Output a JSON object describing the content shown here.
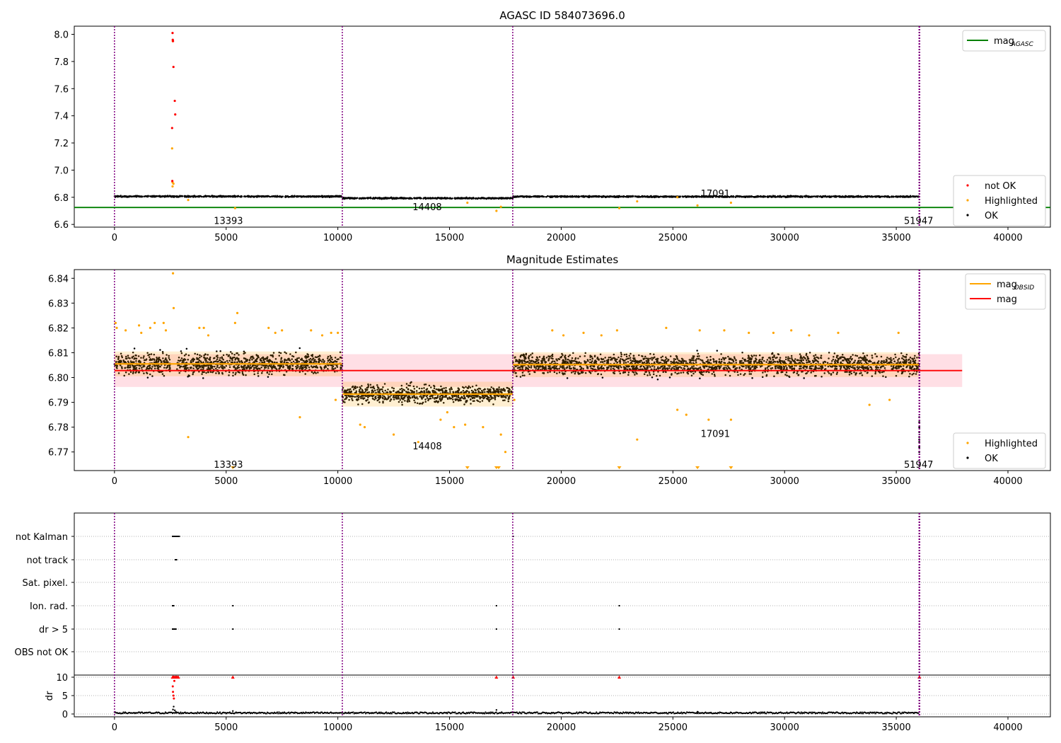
{
  "chart_data": [
    {
      "type": "scatter",
      "title": "AGASC ID 584073696.0",
      "xlim": [
        -1800,
        41900
      ],
      "ylim": [
        6.58,
        8.06
      ],
      "xticks": [
        0,
        5000,
        10000,
        15000,
        20000,
        25000,
        30000,
        35000,
        40000
      ],
      "yticks": [
        6.6,
        6.8,
        7.0,
        7.2,
        7.4,
        7.6,
        7.8,
        8.0
      ],
      "grid": false,
      "obs_boundaries": [
        0,
        10200,
        17830,
        36020,
        36050
      ],
      "obs_labels": [
        {
          "text": "13393",
          "x": 5100,
          "y": 6.63
        },
        {
          "text": "14408",
          "x": 14000,
          "y": 6.73
        },
        {
          "text": "17091",
          "x": 26900,
          "y": 6.83
        },
        {
          "text": "51947",
          "x": 36000,
          "y": 6.63
        }
      ],
      "lines": [
        {
          "name": "mag$_{AGASC}$",
          "display_main": "mag",
          "display_sub": "AGASC",
          "color": "#008000",
          "y": 6.725,
          "x": [
            -1800,
            41900
          ]
        }
      ],
      "legend_upper": {
        "position": "top-right",
        "entries": [
          {
            "main": "mag",
            "sub": "AGASC",
            "color": "#008000",
            "kind": "line"
          }
        ]
      },
      "legend_lower": {
        "position": "bottom-right",
        "entries": [
          {
            "label": "not OK",
            "color": "#ff0000",
            "kind": "dot"
          },
          {
            "label": "Highlighted",
            "color": "#ffa500",
            "kind": "dot"
          },
          {
            "label": "OK",
            "color": "#000000",
            "kind": "dot"
          }
        ]
      },
      "series": [
        {
          "name": "OK",
          "color": "#000000",
          "segments": [
            {
              "x0": 0,
              "x1": 10200,
              "center": 6.806,
              "spread": 0.006
            },
            {
              "x0": 10200,
              "x1": 17830,
              "center": 6.793,
              "spread": 0.006
            },
            {
              "x0": 17830,
              "x1": 36020,
              "center": 6.805,
              "spread": 0.006
            }
          ]
        },
        {
          "name": "not OK",
          "color": "#ff0000",
          "x": [
            2600,
            2610,
            2620,
            2640,
            2700,
            2720,
            2580,
            2590
          ],
          "y": [
            8.01,
            7.96,
            7.95,
            7.76,
            7.51,
            7.41,
            7.31,
            6.92
          ]
        },
        {
          "name": "Highlighted",
          "color": "#ffa500",
          "x": [
            2580,
            2600,
            2640,
            3300,
            5400,
            15800,
            17100,
            17300,
            22600,
            23400,
            25200,
            26100,
            27600,
            2600,
            2610
          ],
          "y": [
            7.16,
            6.88,
            6.9,
            6.78,
            6.72,
            6.76,
            6.7,
            6.73,
            6.72,
            6.77,
            6.8,
            6.74,
            6.76,
            6.91,
            7.95
          ]
        }
      ]
    },
    {
      "type": "scatter",
      "title": "Magnitude Estimates",
      "xlim": [
        -1800,
        41900
      ],
      "ylim": [
        6.7625,
        6.8435
      ],
      "xticks": [
        0,
        5000,
        10000,
        15000,
        20000,
        25000,
        30000,
        35000,
        40000
      ],
      "yticks": [
        6.77,
        6.78,
        6.79,
        6.8,
        6.81,
        6.82,
        6.83,
        6.84
      ],
      "grid": false,
      "obs_boundaries": [
        0,
        10200,
        17830,
        36020,
        36050
      ],
      "obs_labels": [
        {
          "text": "13393",
          "x": 5100,
          "y": 6.765
        },
        {
          "text": "14408",
          "x": 14000,
          "y": 6.7725
        },
        {
          "text": "17091",
          "x": 26900,
          "y": 6.7775
        },
        {
          "text": "51947",
          "x": 36000,
          "y": 6.765
        }
      ],
      "mag": {
        "name": "mag",
        "value": 6.8028,
        "band": [
          6.7962,
          6.8094
        ],
        "x": [
          0,
          37950
        ],
        "color": "#ff0000",
        "band_color": "#ffc0cb"
      },
      "mag_obsid": {
        "name": "mag$_{OBSID}$",
        "color": "#ffa500",
        "segments": [
          {
            "x0": 0,
            "x1": 10200,
            "value": 6.8055,
            "lo": 6.8005,
            "hi": 6.8105
          },
          {
            "x0": 10200,
            "x1": 17830,
            "value": 6.7933,
            "lo": 6.7883,
            "hi": 6.7983
          },
          {
            "x0": 17830,
            "x1": 36020,
            "value": 6.8052,
            "lo": 6.8002,
            "hi": 6.8102
          }
        ]
      },
      "legend_upper": {
        "position": "top-right",
        "entries": [
          {
            "main": "mag",
            "sub": "OBSID",
            "color": "#ffa500",
            "kind": "line"
          },
          {
            "main": "mag",
            "sub": "",
            "color": "#ff0000",
            "kind": "line"
          }
        ]
      },
      "legend_lower": {
        "position": "bottom-right",
        "entries": [
          {
            "label": "Highlighted",
            "color": "#ffa500",
            "kind": "dot"
          },
          {
            "label": "OK",
            "color": "#000000",
            "kind": "dot"
          }
        ]
      },
      "series": [
        {
          "name": "OK",
          "color": "#000000",
          "segments": [
            {
              "x0": 0,
              "x1": 2500,
              "center": 6.8055,
              "spread": 0.0055
            },
            {
              "x0": 2800,
              "x1": 10200,
              "center": 6.8055,
              "spread": 0.0055
            },
            {
              "x0": 10200,
              "x1": 17830,
              "center": 6.7933,
              "spread": 0.0045
            },
            {
              "x0": 17830,
              "x1": 36020,
              "center": 6.8052,
              "spread": 0.0055
            }
          ]
        },
        {
          "name": "OK tail",
          "color": "#000000",
          "x": [
            36030,
            36030,
            36030,
            36030,
            36030,
            36030,
            36030,
            36030,
            36030
          ],
          "y": [
            6.784,
            6.782,
            6.78,
            6.778,
            6.776,
            6.775,
            6.774,
            6.772,
            6.77
          ]
        },
        {
          "name": "Highlighted",
          "color": "#ffa500",
          "x": [
            50,
            100,
            500,
            1100,
            1200,
            1600,
            1800,
            2200,
            2300,
            2650,
            2620,
            3300,
            3800,
            4000,
            4200,
            5500,
            5400,
            6900,
            7200,
            7500,
            8300,
            8800,
            9300,
            9700,
            9900,
            10000,
            11000,
            11200,
            12500,
            13600,
            14600,
            14900,
            15200,
            15700,
            16500,
            17300,
            17500,
            17900,
            19600,
            20100,
            21000,
            21800,
            22500,
            23400,
            24700,
            25200,
            25600,
            26200,
            26600,
            27300,
            27600,
            28400,
            29500,
            30300,
            31100,
            32400,
            33800,
            34700,
            35100
          ],
          "y": [
            6.822,
            6.82,
            6.819,
            6.821,
            6.818,
            6.82,
            6.822,
            6.822,
            6.819,
            6.828,
            6.842,
            6.776,
            6.82,
            6.82,
            6.817,
            6.826,
            6.822,
            6.82,
            6.818,
            6.819,
            6.784,
            6.819,
            6.817,
            6.818,
            6.791,
            6.818,
            6.781,
            6.78,
            6.777,
            6.774,
            6.783,
            6.786,
            6.78,
            6.781,
            6.78,
            6.777,
            6.77,
            6.791,
            6.819,
            6.817,
            6.818,
            6.817,
            6.819,
            6.775,
            6.82,
            6.787,
            6.785,
            6.819,
            6.783,
            6.819,
            6.783,
            6.818,
            6.818,
            6.819,
            6.817,
            6.818,
            6.789,
            6.791,
            6.818
          ]
        },
        {
          "name": "Highlighted below range",
          "color": "#ffa500",
          "marker": "triangle-down",
          "x": [
            5300,
            15800,
            17100,
            17200,
            22600,
            26100,
            27600
          ],
          "y": [
            6.763,
            6.763,
            6.763,
            6.763,
            6.763,
            6.763,
            6.763
          ]
        }
      ]
    },
    {
      "type": "scatter",
      "title": "",
      "xlim": [
        -1800,
        41900
      ],
      "xticks": [
        0,
        5000,
        10000,
        15000,
        20000,
        25000,
        30000,
        35000,
        40000
      ],
      "obs_boundaries": [
        0,
        10200,
        17830,
        36020,
        36050
      ],
      "flag_rows": [
        "not Kalman",
        "not track",
        "Sat. pixel.",
        "Ion. rad.",
        "dr > 5",
        "OBS not OK"
      ],
      "flags": [
        {
          "row": "not Kalman",
          "x": [
            2600,
            2650,
            2700,
            2750,
            2800,
            2850,
            2900,
            17850,
            36030
          ]
        },
        {
          "row": "not track",
          "x": [
            2730,
            2780
          ]
        },
        {
          "row": "Sat. pixel.",
          "x": []
        },
        {
          "row": "Ion. rad.",
          "x": [
            2600,
            2650,
            5300,
            17100,
            22600
          ]
        },
        {
          "row": "dr > 5",
          "x": [
            2600,
            2650,
            2700,
            2750,
            5300,
            17100,
            22600
          ]
        },
        {
          "row": "OBS not OK",
          "x": []
        }
      ],
      "dr": {
        "ylabel": "dr",
        "yticks": [
          0,
          5,
          10
        ],
        "ylim": [
          -0.5,
          11
        ],
        "clip": 10,
        "ok_points": {
          "color": "#000000",
          "x0": 0,
          "x1": 36030,
          "level": 0.1
        },
        "ok_spikes": {
          "x": [
            2620,
            2650,
            2700,
            2750,
            5300,
            17100,
            26100
          ],
          "y": [
            1.2,
            2.0,
            1.0,
            0.6,
            0.8,
            1.1,
            0.6
          ]
        },
        "clipped": {
          "color": "#ff0000",
          "x": [
            2600,
            2630,
            2660,
            2700,
            2740,
            2780,
            2820,
            2860,
            5300,
            17100,
            17850,
            22600,
            36030,
            36040
          ],
          "y": [
            10,
            10,
            10,
            10,
            10,
            10,
            10,
            10,
            10,
            10,
            10,
            10,
            10,
            10
          ]
        },
        "red_values": {
          "color": "#ff0000",
          "x": [
            2610,
            2620,
            2640,
            2660,
            2680
          ],
          "y": [
            7.5,
            6.0,
            5.0,
            4.2,
            9.0
          ]
        }
      }
    }
  ]
}
